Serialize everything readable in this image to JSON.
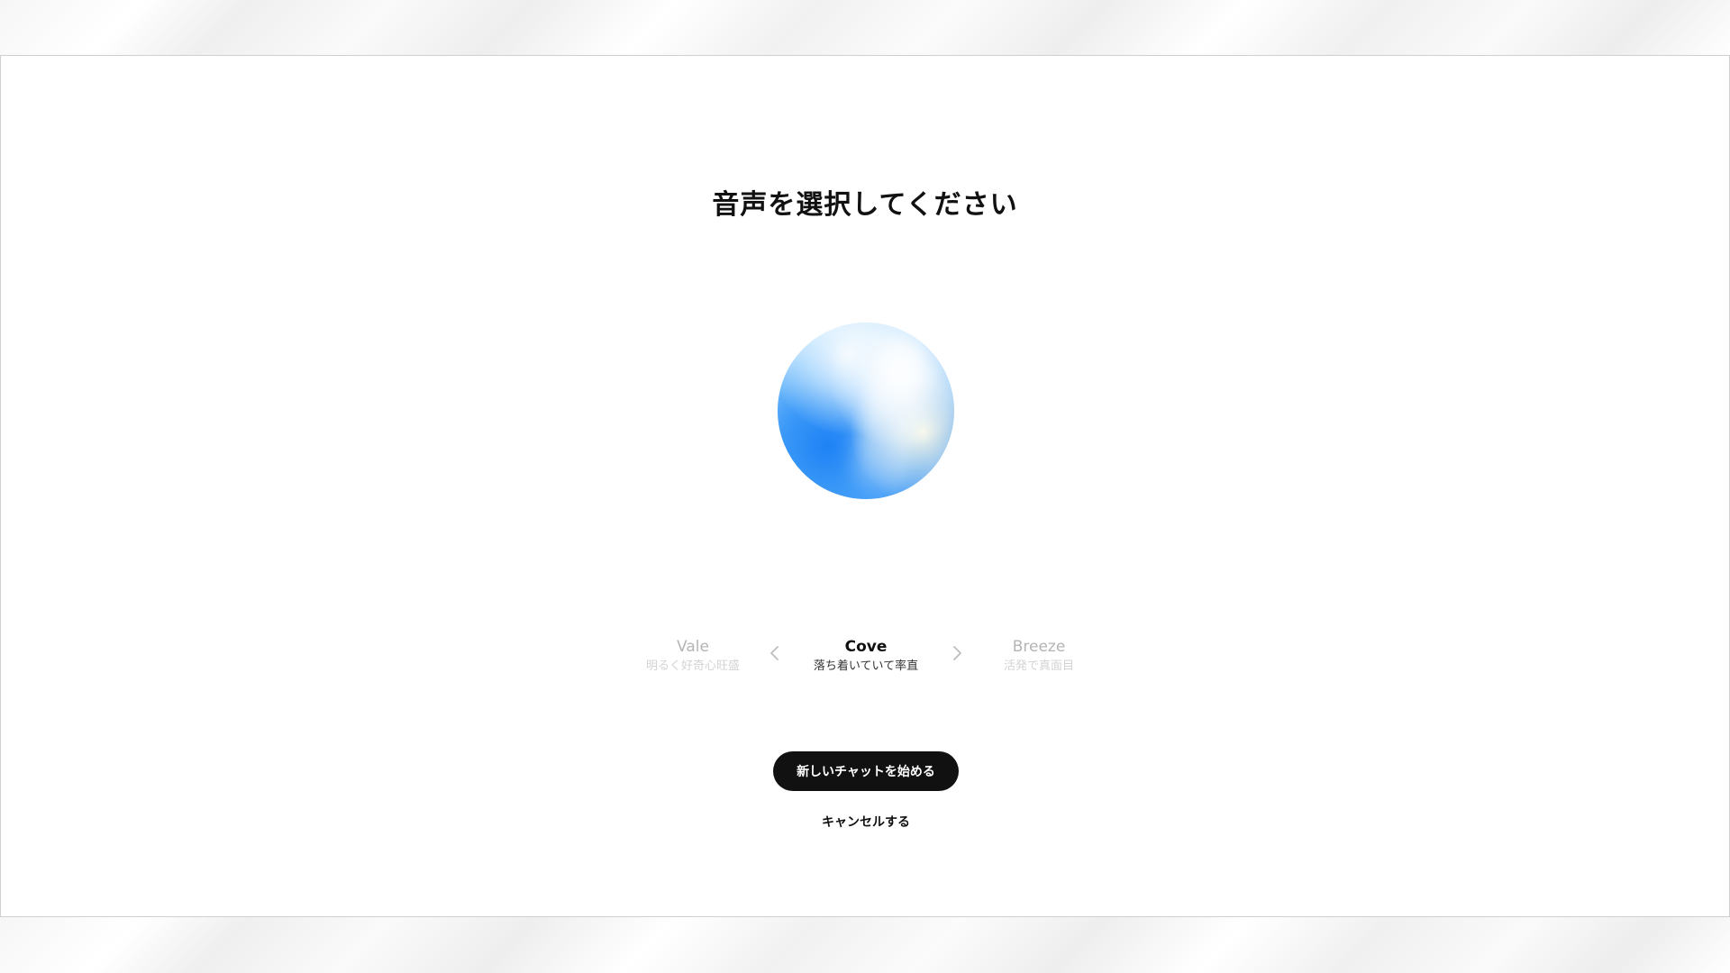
{
  "page": {
    "title": "音声を選択してください"
  },
  "orb": {
    "colors": [
      "#1e82f5",
      "#8fc8fa",
      "#d6efff",
      "#fffae6"
    ]
  },
  "voices": [
    {
      "name": "Vale",
      "description": "明るく好奇心旺盛"
    },
    {
      "name": "Cove",
      "description": "落ち着いていて率直"
    },
    {
      "name": "Breeze",
      "description": "活発で真面目"
    }
  ],
  "selected_voice_index": 1,
  "nav": {
    "prev_icon": "chevron-left-icon",
    "next_icon": "chevron-right-icon"
  },
  "actions": {
    "start_label": "新しいチャットを始める",
    "cancel_label": "キャンセルする"
  },
  "colors": {
    "primary_button": "#111111",
    "primary_text": "#ffffff",
    "muted_text": "#b4b4b4"
  }
}
